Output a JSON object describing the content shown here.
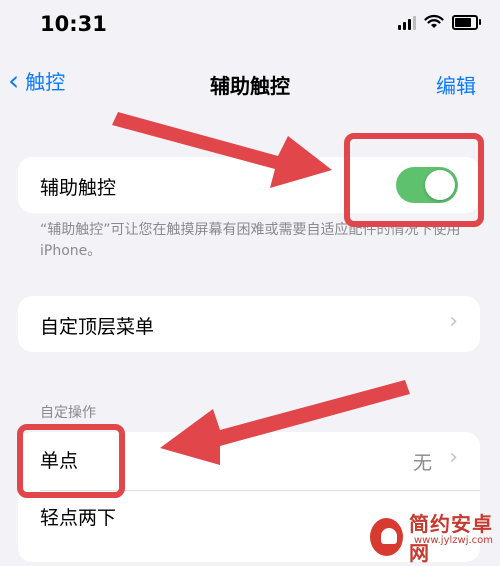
{
  "status_bar": {
    "time": "10:31"
  },
  "nav": {
    "back_label": "触控",
    "title": "辅助触控",
    "edit_label": "编辑"
  },
  "assistive_touch": {
    "label": "辅助触控",
    "enabled": true,
    "footer": "“辅助触控”可让您在触摸屏幕有困难或需要自适应配件的情况下使用 iPhone。"
  },
  "custom_top_menu": {
    "label": "自定顶层菜单"
  },
  "custom_actions": {
    "section_title": "自定操作",
    "rows": [
      {
        "label": "单点",
        "value": "无"
      },
      {
        "label": "轻点两下"
      }
    ]
  },
  "watermark": {
    "text": "简约安卓网",
    "url": "www.jylzwj.com"
  },
  "colors": {
    "accent": "#0a7aff",
    "toggle_on": "#5dc16e",
    "highlight": "#e0464a"
  }
}
